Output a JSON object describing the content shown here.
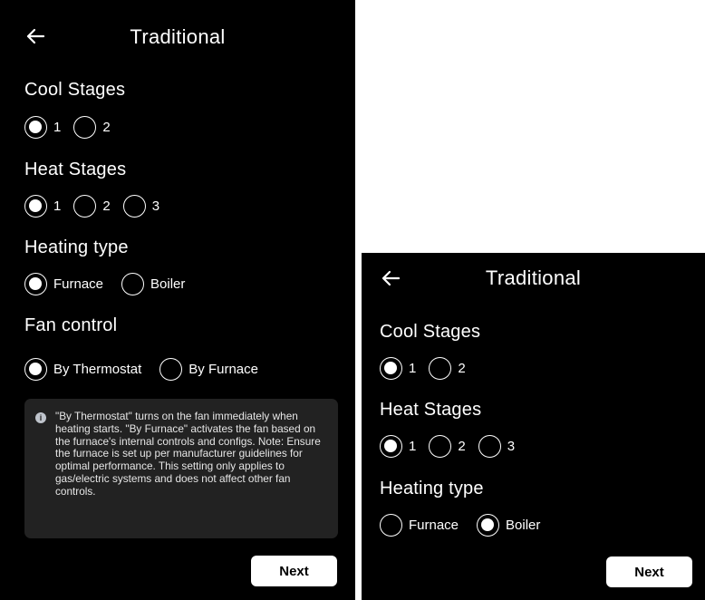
{
  "screens": [
    {
      "title": "Traditional",
      "cool_stages": {
        "label": "Cool Stages",
        "options": [
          "1",
          "2"
        ],
        "selected": "1"
      },
      "heat_stages": {
        "label": "Heat Stages",
        "options": [
          "1",
          "2",
          "3"
        ],
        "selected": "1"
      },
      "heating_type": {
        "label": "Heating type",
        "options": [
          "Furnace",
          "Boiler"
        ],
        "selected": "Furnace"
      },
      "fan_control": {
        "label": "Fan control",
        "options": [
          "By Thermostat",
          "By Furnace"
        ],
        "selected": "By Thermostat"
      },
      "info_text": "\"By Thermostat\" turns on the fan immediately when heating starts. \"By Furnace\" activates the fan based on the furnace's internal controls and configs. Note: Ensure the furnace is set up per manufacturer guidelines for optimal performance.  This setting only applies to gas/electric systems and does not affect other fan controls.",
      "next_label": "Next"
    },
    {
      "title": "Traditional",
      "cool_stages": {
        "label": "Cool Stages",
        "options": [
          "1",
          "2"
        ],
        "selected": "1"
      },
      "heat_stages": {
        "label": "Heat Stages",
        "options": [
          "1",
          "2",
          "3"
        ],
        "selected": "1"
      },
      "heating_type": {
        "label": "Heating type",
        "options": [
          "Furnace",
          "Boiler"
        ],
        "selected": "Boiler"
      },
      "next_label": "Next"
    }
  ],
  "icons": {
    "back": "arrow-left-icon",
    "info": "info-icon"
  },
  "colors": {
    "screen_bg": "#000000",
    "page_bg": "#ffffff",
    "info_bg": "#222222",
    "button_bg": "#ffffff",
    "button_text": "#000000"
  }
}
